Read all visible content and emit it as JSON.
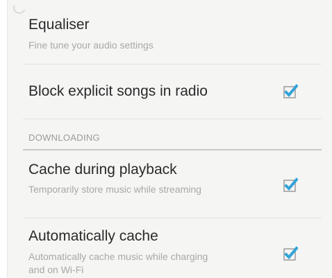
{
  "settings": {
    "equaliser": {
      "title": "Equaliser",
      "subtitle": "Fine tune your audio settings"
    },
    "block_explicit": {
      "title": "Block explicit songs in radio",
      "checked": true
    },
    "section_downloading": {
      "label": "DOWNLOADING"
    },
    "cache_playback": {
      "title": "Cache during playback",
      "subtitle": "Temporarily store music while streaming",
      "checked": true
    },
    "auto_cache": {
      "title": "Automatically cache",
      "subtitle": "Automatically cache music while charging and on Wi-Fi",
      "checked": true
    }
  },
  "colors": {
    "accent": "#33a3d8",
    "background": "#f5f5f4"
  },
  "icons": {
    "checkbox": "checkbox-checked-icon"
  }
}
